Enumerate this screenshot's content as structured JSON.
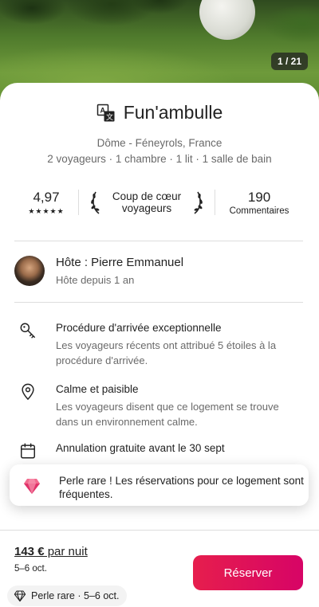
{
  "gallery": {
    "counter": "1 / 21"
  },
  "listing": {
    "title": "Fun'ambulle",
    "location": "Dôme - Féneyrols, France",
    "details": "2 voyageurs · 1 chambre · 1 lit · 1 salle de bain"
  },
  "stats": {
    "rating": "4,97",
    "stars": "★★★★★",
    "rating_value": 5,
    "favorite_label": "Coup de cœur voyageurs",
    "reviews_count": "190",
    "reviews_label": "Commentaires"
  },
  "host": {
    "name": "Hôte : Pierre Emmanuel",
    "since": "Hôte depuis 1 an"
  },
  "features": [
    {
      "icon": "key-icon",
      "title": "Procédure d'arrivée exceptionnelle",
      "description": "Les voyageurs récents ont attribué 5 étoiles à la procédure d'arrivée."
    },
    {
      "icon": "map-pin-icon",
      "title": "Calme et paisible",
      "description": "Les voyageurs disent que ce logement se trouve dans un environnement calme."
    },
    {
      "icon": "calendar-icon",
      "title": "Annulation gratuite avant le 30 sept"
    }
  ],
  "toast": {
    "icon": "gem-icon",
    "text": "Perle rare ! Les réservations pour ce logement sont fréquentes."
  },
  "footer": {
    "price": "143 €",
    "price_suffix": " par nuit",
    "dates": "5–6 oct.",
    "reserve_label": "Réserver",
    "chip_label": "Perle rare · 5–6 oct."
  },
  "colors": {
    "accent": "#e61e4d",
    "accent_end": "#d70466",
    "text": "#222222",
    "muted": "#6a6a6a"
  }
}
